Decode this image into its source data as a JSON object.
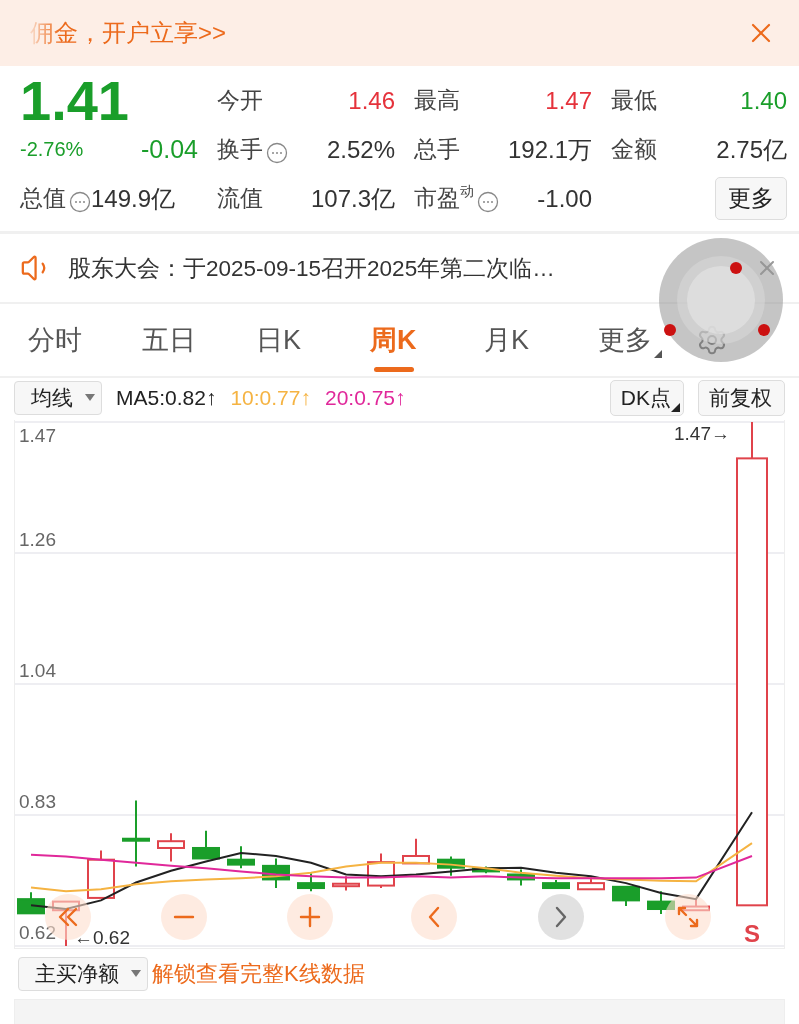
{
  "banner": {
    "text": "佣金，开户立享>>"
  },
  "quote": {
    "price": "1.41",
    "change_pct": "-2.76%",
    "change": "-0.04",
    "color": "#1a9e2a",
    "total_value": {
      "label": "总值",
      "value": "149.9亿",
      "info": true
    },
    "fields": [
      {
        "label": "今开",
        "value": "1.46",
        "color": "#e5323b",
        "info": false
      },
      {
        "label": "最高",
        "value": "1.47",
        "color": "#e5323b",
        "info": false
      },
      {
        "label": "最低",
        "value": "1.40",
        "color": "#1a9e2a",
        "info": false
      },
      {
        "label": "换手",
        "value": "2.52%",
        "color": "#333333",
        "info": true
      },
      {
        "label": "总手",
        "value": "192.1万",
        "color": "#333333",
        "info": false
      },
      {
        "label": "金额",
        "value": "2.75亿",
        "color": "#333333",
        "info": false
      },
      {
        "label": "流值",
        "value": "107.3亿",
        "color": "#333333",
        "info": false
      },
      {
        "label": "市盈$^{动}$",
        "value": "-1.00",
        "color": "#333333",
        "info": true
      }
    ],
    "more_button": "更多"
  },
  "notice": {
    "text": "股东大会：于2025-09-15召开2025年第二次临…"
  },
  "tabs": [
    {
      "label": "分时",
      "selected": false,
      "kind": "tab"
    },
    {
      "label": "五日",
      "selected": false,
      "kind": "tab"
    },
    {
      "label": "日K",
      "selected": false,
      "kind": "tab"
    },
    {
      "label": "周K",
      "selected": true,
      "kind": "tab"
    },
    {
      "label": "月K",
      "selected": false,
      "kind": "tab"
    },
    {
      "label": "更多",
      "selected": false,
      "kind": "menu"
    }
  ],
  "toolbar": {
    "indicator": "均线",
    "ma": [
      {
        "text": "MA5:0.82↑",
        "color": "#222222"
      },
      {
        "text": "10:0.77↑",
        "color": "#f5b342"
      },
      {
        "text": "20:0.75↑",
        "color": "#e0289a"
      }
    ],
    "buttons": [
      {
        "label": "DK点",
        "kind": "menu"
      },
      {
        "label": "前复权",
        "kind": "plain"
      }
    ]
  },
  "chart": {
    "y_labels": [
      "1.47",
      "1.26",
      "1.04",
      "0.83",
      "0.62"
    ],
    "high_label": "1.47→",
    "low_label": "←0.62",
    "signal": "S",
    "controls": [
      {
        "kind": "first",
        "disabled": false
      },
      {
        "kind": "zoom_out",
        "disabled": false
      },
      {
        "kind": "zoom_in",
        "disabled": false
      },
      {
        "kind": "prev",
        "disabled": false
      },
      {
        "kind": "next",
        "disabled": true
      },
      {
        "kind": "expand",
        "disabled": false
      }
    ]
  },
  "footer": {
    "indicator": "主买净额",
    "link": "解锁查看完整K线数据"
  }
}
